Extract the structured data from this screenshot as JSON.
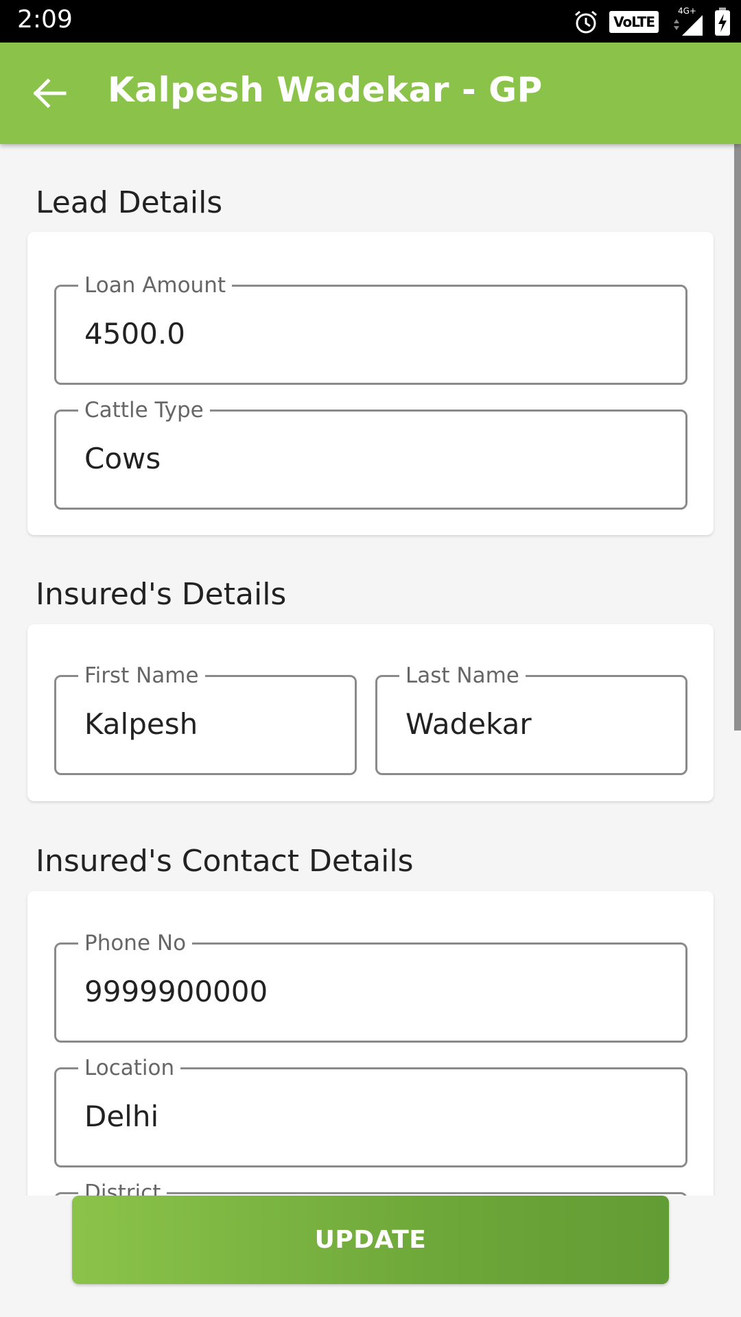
{
  "status_bar": {
    "time": "2:09",
    "network_badge": "VoLTE",
    "signal_label": "4G+"
  },
  "app_bar": {
    "title": "Kalpesh Wadekar - GP"
  },
  "sections": {
    "lead": {
      "title": "Lead Details",
      "loan_amount": {
        "label": "Loan Amount",
        "value": "4500.0"
      },
      "cattle_type": {
        "label": "Cattle Type",
        "value": "Cows"
      }
    },
    "insured": {
      "title": "Insured's Details",
      "first_name": {
        "label": "First Name",
        "value": "Kalpesh"
      },
      "last_name": {
        "label": "Last Name",
        "value": "Wadekar"
      }
    },
    "contact": {
      "title": "Insured's Contact Details",
      "phone": {
        "label": "Phone No",
        "value": "9999900000"
      },
      "location": {
        "label": "Location",
        "value": "Delhi"
      },
      "district": {
        "label": "District",
        "value": ""
      }
    }
  },
  "actions": {
    "update_label": "UPDATE"
  },
  "colors": {
    "primary": "#8bc34a",
    "primary_dark": "#629c34"
  }
}
